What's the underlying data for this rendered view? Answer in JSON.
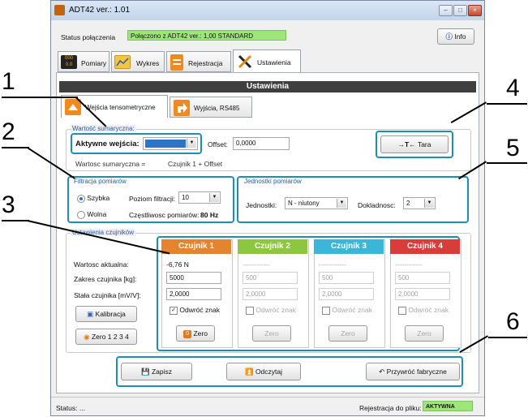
{
  "window": {
    "title": "ADT42  ver.: 1.01",
    "min": "–",
    "max": "□",
    "close": "×"
  },
  "connection": {
    "label": "Status połączenia",
    "value": "Połączono z ADT42 ver.: 1,00 STANDARD",
    "info_button": "Info"
  },
  "main_tabs": [
    {
      "label": "Pomiary",
      "icon": "display-icon"
    },
    {
      "label": "Wykres",
      "icon": "chart-icon"
    },
    {
      "label": "Rejestracja",
      "icon": "clipboard-icon"
    },
    {
      "label": "Ustawienia",
      "icon": "tools-icon"
    }
  ],
  "section_title": "Ustawienia",
  "sub_tabs": [
    {
      "label": "Wejścia tensometryczne",
      "icon": "scale-icon"
    },
    {
      "label": "Wyjścia, RS485",
      "icon": "output-icon"
    }
  ],
  "sum_value": {
    "group_title": "Wartość sumaryczna:",
    "active_inputs_label": "Aktywne wejścia:",
    "active_inputs_value": "",
    "offset_label": "Offset:",
    "offset_value": "0,0000",
    "formula_label": "Wartosc sumaryczna =",
    "formula_value": "Czujnik 1 + Offset",
    "tare_button": "Tara"
  },
  "filter": {
    "group_title": "Filtracja pomiarów",
    "fast": "Szybka",
    "slow": "Wolna",
    "level_label": "Poziom filtracji:",
    "level_value": "10",
    "freq_label": "Częstliwosc pomiarów:",
    "freq_value": "80 Hz"
  },
  "units": {
    "group_title": "Jednostki pomiarów",
    "units_label": "Jednostki:",
    "units_value": "N - niutony",
    "precision_label": "Dokladnosc:",
    "precision_value": "2"
  },
  "sensors_group": {
    "title": "Ustawienia czujników",
    "current_label": "Wartosc aktualna:",
    "range_label": "Zakres czujnika [kg]:",
    "constant_label": "Stała czujnika [mV/V]:",
    "calibration_button": "Kalibracja",
    "zero_all_button": "Zero 1 2 3 4"
  },
  "sensors": [
    {
      "name": "Czujnik 1",
      "color": "#e5842f",
      "current": "-6,76 N",
      "range": "5000",
      "constant": "2,0000",
      "invert": "Odwróć znak",
      "zero": "Zero",
      "enabled": true
    },
    {
      "name": "Czujnik 2",
      "color": "#8dc63f",
      "current": "------------",
      "range": "500",
      "constant": "2,0000",
      "invert": "Odwróć znak",
      "zero": "Zero",
      "enabled": false
    },
    {
      "name": "Czujnik 3",
      "color": "#3bb5d8",
      "current": "------------",
      "range": "500",
      "constant": "2,0000",
      "invert": "Odwróć znak",
      "zero": "Zero",
      "enabled": false
    },
    {
      "name": "Czujnik 4",
      "color": "#d93d3a",
      "current": "------------",
      "range": "500",
      "constant": "2,0000",
      "invert": "Odwróć znak",
      "zero": "Zero",
      "enabled": false
    }
  ],
  "actions": {
    "save": "Zapisz",
    "read": "Odczytaj",
    "restore": "Przywróć fabryczne"
  },
  "statusbar": {
    "status_label": "Status:",
    "status_value": "...",
    "log_label": "Rejestracja do pliku:",
    "log_value": "AKTYWNA"
  },
  "callouts": [
    "1",
    "2",
    "3",
    "4",
    "5",
    "6"
  ],
  "colors": {
    "highlight": "#1e8fb3",
    "status_green": "#9ee57a",
    "header_dark": "#3f3f3f"
  }
}
